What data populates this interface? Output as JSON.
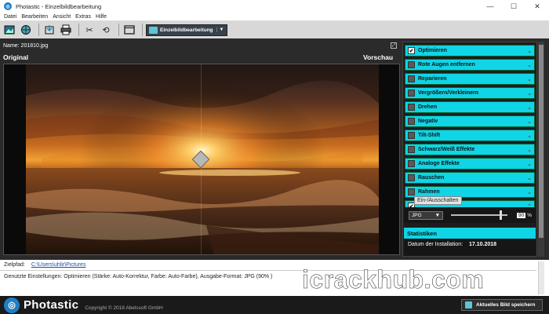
{
  "window": {
    "title": "Photastic - Einzelbildbearbeitung",
    "minimize": "—",
    "maximize": "☐",
    "close": "✕"
  },
  "menu": [
    "Datei",
    "Bearbeiten",
    "Ansicht",
    "Extras",
    "Hilfe"
  ],
  "toolbar": {
    "mode_label": "Einzelbildbearbeitung"
  },
  "image": {
    "name_label": "Name: 201810.jpg",
    "original_label": "Original",
    "preview_label": "Vorschau"
  },
  "zoom": {
    "value": "110",
    "unit": "%",
    "minus": "⊖",
    "plus": "⊕"
  },
  "sidebar": {
    "items": [
      {
        "label": "Optimieren",
        "checked": true
      },
      {
        "label": "Rote Augen entfernen",
        "checked": false
      },
      {
        "label": "Reparieren",
        "checked": false
      },
      {
        "label": "Vergrößern/Verkleinern",
        "checked": false
      },
      {
        "label": "Drehen",
        "checked": false
      },
      {
        "label": "Negativ",
        "checked": false
      },
      {
        "label": "Tilt-Shift",
        "checked": false
      },
      {
        "label": "Schwarz/Weiß Effekte",
        "checked": false
      },
      {
        "label": "Analoge Effekte",
        "checked": false
      },
      {
        "label": "Rauschen",
        "checked": false
      },
      {
        "label": "Rahmen",
        "checked": false
      }
    ],
    "tooltip": "Ein-/Ausschalten",
    "format": {
      "selected": "JPG",
      "quality_value": "90",
      "unit": "%"
    },
    "stats": {
      "header": "Statistiken",
      "install_label": "Datum der Installation:",
      "install_date": "17.10.2018"
    }
  },
  "bottom": {
    "target_label": "Zielpfad:",
    "target_path": "C:\\Users\\uhlir\\Pictures",
    "settings_text": "Genutzte Einstellungen: Optimieren (Stärke: Auto-Korrektur, Farbe: Auto-Farbe), Ausgabe-Format: JPG (90% )"
  },
  "footer": {
    "brand": "Photastic",
    "copyright": "Copyright © 2018 Abelssoft GmbH",
    "save_button": "Aktuelles Bild speichern"
  },
  "overlay": {
    "watermark": "icrackhub.com"
  },
  "colors": {
    "accent": "#0fd5e6",
    "background": "#2b2b2b",
    "brand_blue": "#1f7fc4"
  }
}
